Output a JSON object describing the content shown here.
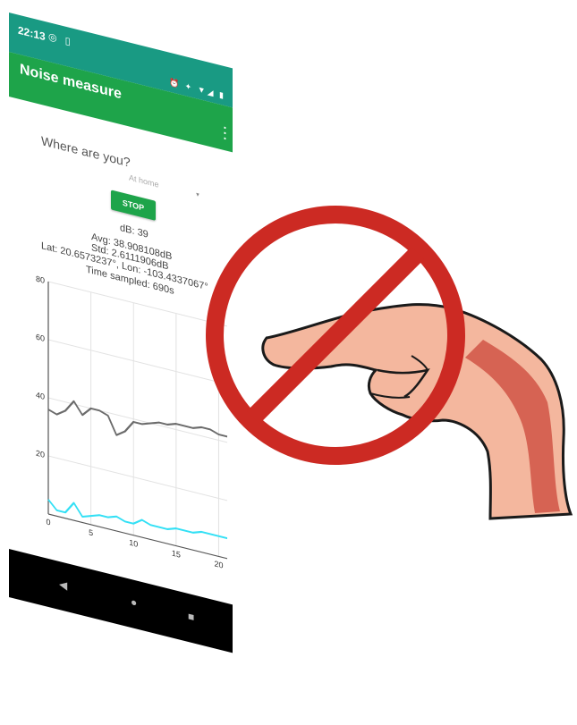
{
  "status_bar": {
    "time": "22:13",
    "left_icons": "◎ ▯",
    "right_icons": "⏰ ✦ ▼◢ ▮"
  },
  "app_bar": {
    "title": "Noise measure"
  },
  "form": {
    "where_label": "Where are you?",
    "location_selected": "At home"
  },
  "buttons": {
    "stop_label": "STOP"
  },
  "stats": {
    "db_now": "dB: 39",
    "avg": "Avg: 38.908108dB",
    "std": "Std: 2.6111906dB",
    "latlon": "Lat: 20.6573237°, Lon: -103.4337067°",
    "time_sampled": "Time sampled: 690s"
  },
  "chart_data": {
    "type": "line",
    "xlim": [
      0,
      21
    ],
    "ylim": [
      0,
      80
    ],
    "x_ticks": [
      0,
      5,
      10,
      15,
      20
    ],
    "y_ticks": [
      20,
      40,
      60,
      80
    ],
    "x_tick_labels": [
      "0",
      "5",
      "10",
      "15",
      "20"
    ],
    "y_tick_labels": [
      "20",
      "40",
      "60",
      "80"
    ],
    "grid": true,
    "series": [
      {
        "color": "#6b6b6b",
        "x": [
          0,
          1,
          2,
          3,
          4,
          5,
          6,
          7,
          8,
          9,
          10,
          11,
          12,
          13,
          14,
          15,
          16,
          17,
          18,
          19,
          20,
          21
        ],
        "values": [
          36,
          35,
          37,
          41,
          37,
          40,
          40,
          39,
          33,
          35,
          39,
          39,
          40,
          41,
          41,
          42,
          42,
          42,
          43,
          43,
          42,
          42
        ]
      },
      {
        "color": "#33e0f5",
        "x": [
          0,
          1,
          2,
          3,
          4,
          5,
          6,
          7,
          8,
          9,
          10,
          11,
          12,
          13,
          14,
          15,
          16,
          17,
          18,
          19,
          20,
          21
        ],
        "values": [
          5,
          2,
          2,
          6,
          2,
          3,
          4,
          4,
          5,
          4,
          4,
          6,
          5,
          5,
          5,
          6,
          6,
          6,
          7,
          7,
          7,
          7
        ]
      }
    ]
  },
  "nav_bar": {
    "back": "◀",
    "home": "●",
    "recent": "■"
  },
  "overlay": {
    "sign": "prohibition-sign",
    "hand": "pointing-hand",
    "sign_color": "#cc2a23",
    "skin_color": "#f4b79e",
    "shade_color": "#d35a4a"
  }
}
